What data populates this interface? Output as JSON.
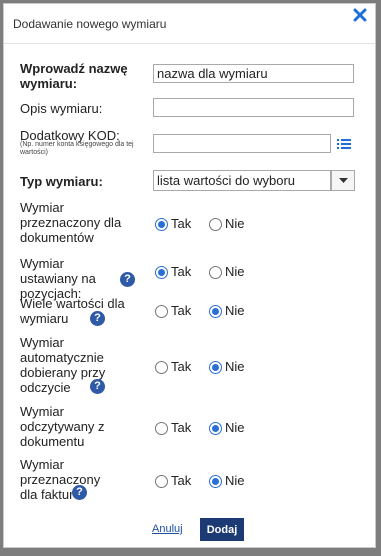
{
  "dialog": {
    "title": "Dodawanie nowego wymiaru",
    "close_icon": "close-x-icon"
  },
  "form": {
    "name": {
      "label": "Wprowadź nazwę wymiaru:",
      "value": "nazwa dla wymiaru"
    },
    "description": {
      "label": "Opis wymiaru:",
      "value": ""
    },
    "extra_code": {
      "label": "Dodatkowy KOD:",
      "hint": "(Np. numer konta księgowego dla tej wartości)",
      "value": "",
      "icon": "list-icon"
    },
    "type": {
      "label": "Typ wymiaru:",
      "value": "lista wartości do wyboru",
      "icon": "chevron-down-icon"
    },
    "options": [
      {
        "label": "Wymiar przeznaczony dla dokumentów",
        "help": false,
        "selected": "Tak"
      },
      {
        "label": "Wymiar ustawiany na pozycjach:",
        "help": true,
        "selected": "Tak"
      },
      {
        "label": "Wiele wartości dla wymiaru",
        "help": true,
        "selected": "Nie"
      },
      {
        "label": "Wymiar automatycznie dobierany przy odczycie",
        "help": true,
        "selected": "Nie"
      },
      {
        "label": "Wymiar odczytywany z dokumentu",
        "help": false,
        "selected": "Nie"
      },
      {
        "label": "Wymiar przeznaczony dla faktur",
        "help": true,
        "selected": "Nie"
      }
    ],
    "yes_label": "Tak",
    "no_label": "Nie"
  },
  "help_glyph": "?",
  "buttons": {
    "cancel": "Anuluj",
    "add": "Dodaj"
  },
  "colors": {
    "accent": "#2a6fd6",
    "primary_button": "#1c3a73",
    "help_icon": "#2f5aa8",
    "close_icon": "#1e6fd9"
  }
}
